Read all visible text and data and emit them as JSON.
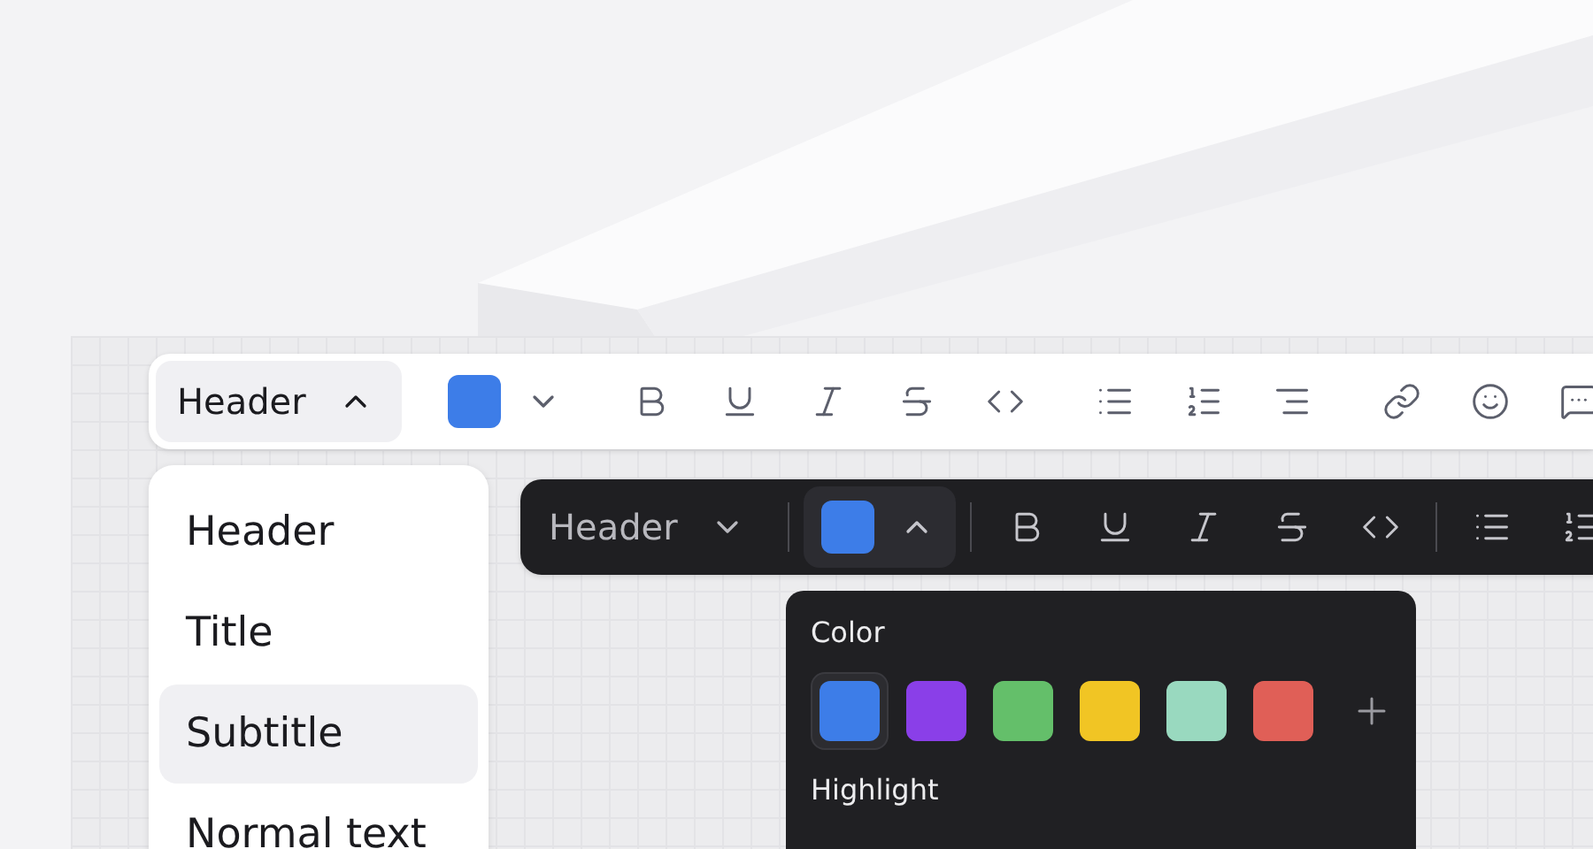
{
  "light_toolbar": {
    "style_select": {
      "label": "Header",
      "expanded": true
    },
    "text_color": {
      "color": "#3d7de8",
      "expanded": false
    }
  },
  "style_menu": {
    "items": [
      {
        "label": "Header",
        "selected": false
      },
      {
        "label": "Title",
        "selected": false
      },
      {
        "label": "Subtitle",
        "selected": true
      },
      {
        "label": "Normal text",
        "selected": false
      }
    ]
  },
  "dark_toolbar": {
    "style_select": {
      "label": "Header",
      "expanded": false
    },
    "text_color": {
      "color": "#3d7de8",
      "expanded": true
    }
  },
  "color_popover": {
    "color_label": "Color",
    "swatches": [
      {
        "color": "#3d7de8",
        "selected": true
      },
      {
        "color": "#8a3fe8",
        "selected": false
      },
      {
        "color": "#64bf6a",
        "selected": false
      },
      {
        "color": "#f1c524",
        "selected": false
      },
      {
        "color": "#99d9bf",
        "selected": false
      },
      {
        "color": "#e05f57",
        "selected": false
      }
    ],
    "highlight_label": "Highlight"
  }
}
